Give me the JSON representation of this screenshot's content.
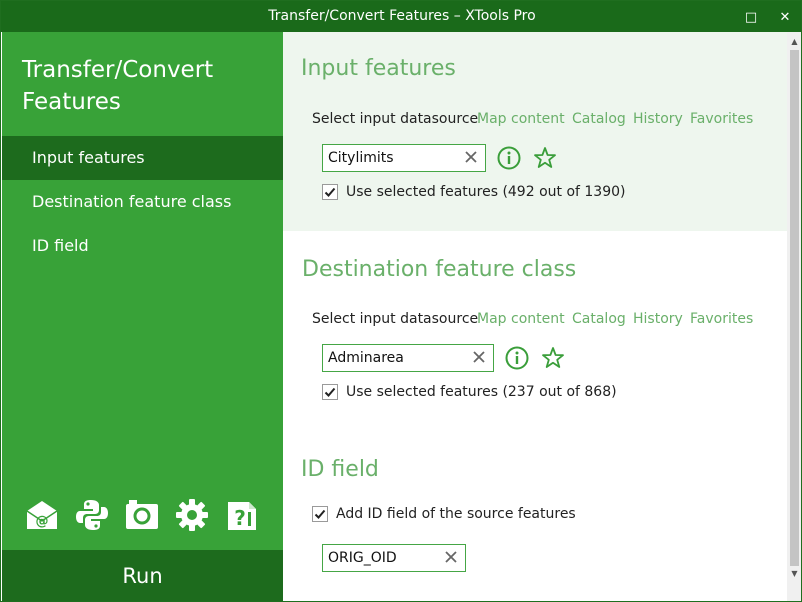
{
  "window": {
    "title": "Transfer/Convert Features – XTools Pro",
    "maximize_glyph": "□",
    "close_glyph": "✕"
  },
  "sidebar": {
    "app_title": "Transfer/Convert Features",
    "items": [
      {
        "label": "Input features",
        "active": true
      },
      {
        "label": "Destination feature class",
        "active": false
      },
      {
        "label": "ID field",
        "active": false
      }
    ],
    "tools": [
      "email-icon",
      "python-icon",
      "camera-icon",
      "gear-icon",
      "help-icon"
    ],
    "run_label": "Run"
  },
  "input_features": {
    "title": "Input features",
    "source_label": "Select input datasource",
    "links": [
      "Map content",
      "Catalog",
      "History",
      "Favorites"
    ],
    "value": "Citylimits",
    "use_selected": {
      "checked": true,
      "label": "Use selected features (492 out of 1390)"
    }
  },
  "destination": {
    "title": "Destination feature class",
    "source_label": "Select input datasource",
    "links": [
      "Map content",
      "Catalog",
      "History",
      "Favorites"
    ],
    "value": "Adminarea",
    "use_selected": {
      "checked": true,
      "label": "Use selected features (237 out of 868)"
    }
  },
  "id_field": {
    "title": "ID field",
    "add_id": {
      "checked": true,
      "label": "Add ID field of the source features"
    },
    "value": "ORIG_OID"
  },
  "colors": {
    "titlebar": "#1a6a1a",
    "sidebar": "#38a238",
    "sidebar_active": "#1d6b1d",
    "accent": "#6ab06a",
    "icon_green": "#3a9e3a",
    "section_bg": "#eef6ee"
  },
  "scrollbar": {
    "up_glyph": "▲",
    "down_glyph": "▼"
  }
}
